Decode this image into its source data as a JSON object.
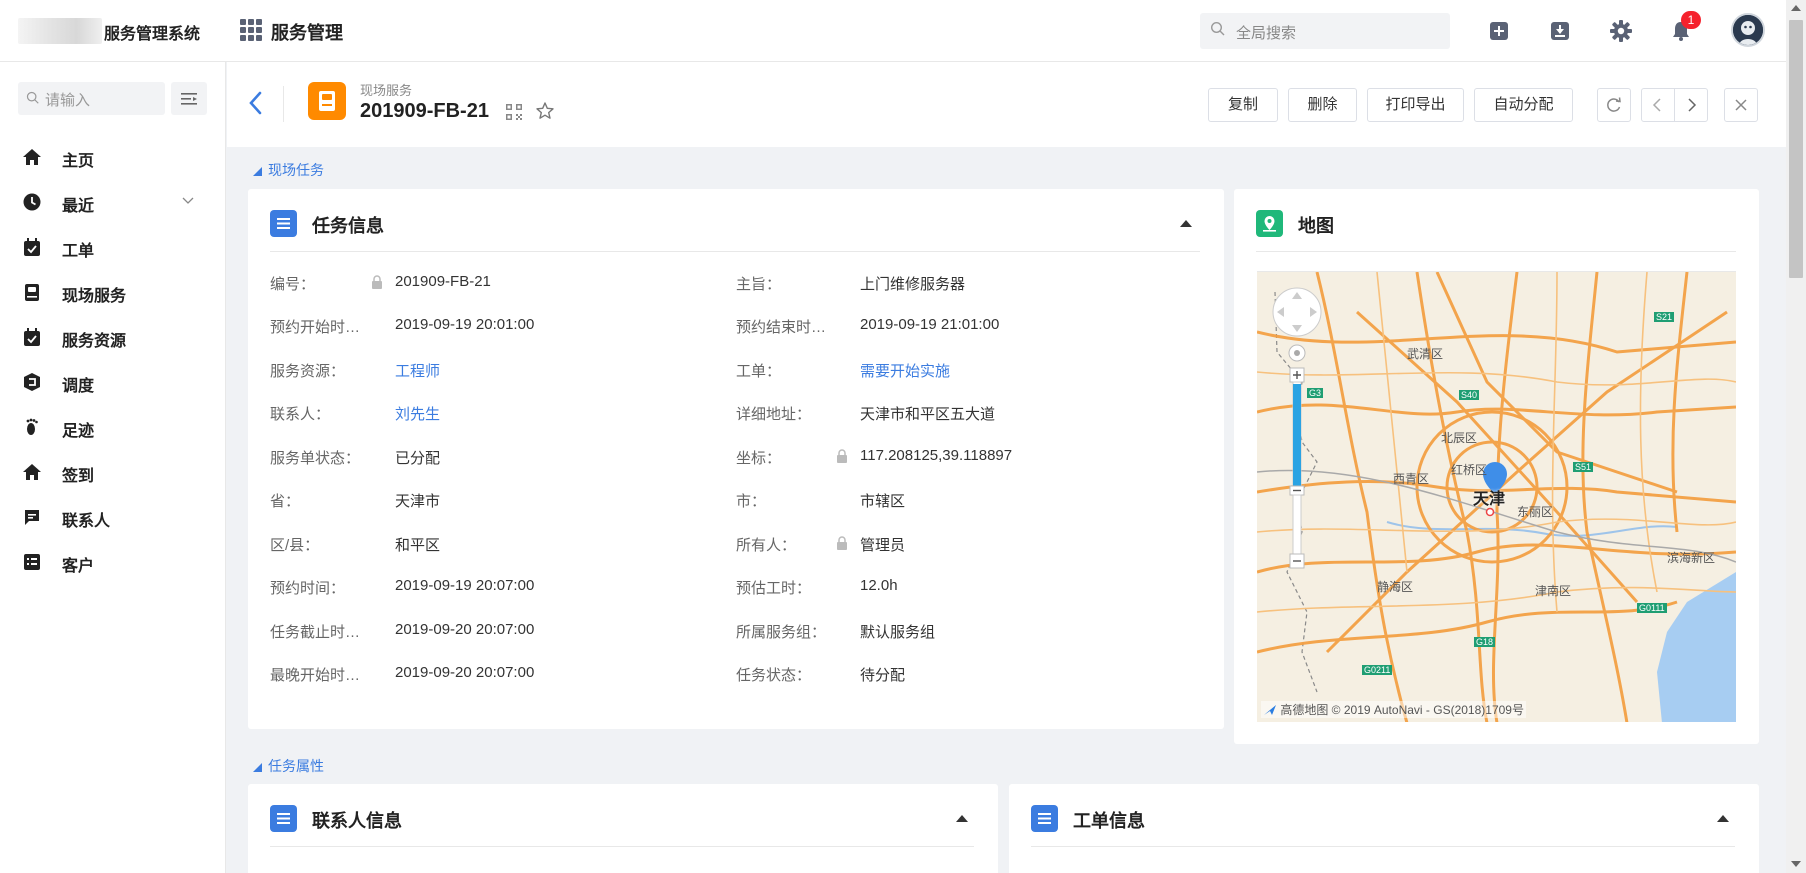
{
  "app": {
    "system_name": "服务管理系统",
    "module_name": "服务管理",
    "search_placeholder": "全局搜索",
    "notification_count": "1"
  },
  "sidebar": {
    "search_placeholder": "请输入",
    "items": [
      {
        "label": "主页",
        "icon": "home-icon"
      },
      {
        "label": "最近",
        "icon": "clock-icon"
      },
      {
        "label": "工单",
        "icon": "calendar-check-icon"
      },
      {
        "label": "现场服务",
        "icon": "book-icon"
      },
      {
        "label": "服务资源",
        "icon": "calendar-check-icon"
      },
      {
        "label": "调度",
        "icon": "dispatch-icon"
      },
      {
        "label": "足迹",
        "icon": "footprint-icon"
      },
      {
        "label": "签到",
        "icon": "home-icon"
      },
      {
        "label": "联系人",
        "icon": "chat-icon"
      },
      {
        "label": "客户",
        "icon": "list-icon"
      }
    ]
  },
  "header": {
    "object_type": "现场服务",
    "title": "201909-FB-21",
    "buttons": {
      "copy": "复制",
      "delete": "删除",
      "print_export": "打印导出",
      "auto_assign": "自动分配"
    }
  },
  "sections": {
    "field_task": "现场任务",
    "task_attributes": "任务属性"
  },
  "task_info": {
    "title": "任务信息",
    "left": [
      {
        "label": "编号：",
        "value": "201909-FB-21",
        "locked": true
      },
      {
        "label": "预约开始时…",
        "value": "2019-09-19 20:01:00"
      },
      {
        "label": "服务资源：",
        "value": "工程师",
        "link": true
      },
      {
        "label": "联系人：",
        "value": "刘先生",
        "link": true
      },
      {
        "label": "服务单状态：",
        "value": "已分配"
      },
      {
        "label": "省：",
        "value": "天津市"
      },
      {
        "label": "区/县：",
        "value": "和平区"
      },
      {
        "label": "预约时间：",
        "value": "2019-09-19 20:07:00"
      },
      {
        "label": "任务截止时…",
        "value": "2019-09-20 20:07:00"
      },
      {
        "label": "最晚开始时…",
        "value": "2019-09-20 20:07:00"
      }
    ],
    "right": [
      {
        "label": "主旨：",
        "value": "上门维修服务器"
      },
      {
        "label": "预约结束时…",
        "value": "2019-09-19 21:01:00"
      },
      {
        "label": "工单：",
        "value": "需要开始实施",
        "link": true
      },
      {
        "label": "详细地址：",
        "value": "天津市和平区五大道"
      },
      {
        "label": "坐标：",
        "value": "117.208125,39.118897",
        "locked": true
      },
      {
        "label": "市：",
        "value": "市辖区"
      },
      {
        "label": "所有人：",
        "value": "管理员",
        "locked": true
      },
      {
        "label": "预估工时：",
        "value": "12.0h"
      },
      {
        "label": "所属服务组：",
        "value": "默认服务组"
      },
      {
        "label": "任务状态：",
        "value": "待分配"
      }
    ]
  },
  "map_card": {
    "title": "地图",
    "city_label": "天津",
    "district_labels": [
      "武清区",
      "北辰区",
      "红桥区",
      "西青区",
      "东丽区",
      "静海区",
      "津南区",
      "滨海新区"
    ],
    "road_badges": [
      "S21",
      "S40",
      "G3",
      "S51",
      "G0111",
      "G18",
      "G0211"
    ],
    "credit": "高德地图 © 2019 AutoNavi - GS(2018)1709号"
  },
  "contact_card": {
    "title": "联系人信息"
  },
  "work_order_card": {
    "title": "工单信息"
  },
  "colors": {
    "accent_blue": "#3b7ce0",
    "object_orange": "#ff8a00",
    "map_green": "#1fb87a",
    "badge_red": "#f5222d"
  }
}
